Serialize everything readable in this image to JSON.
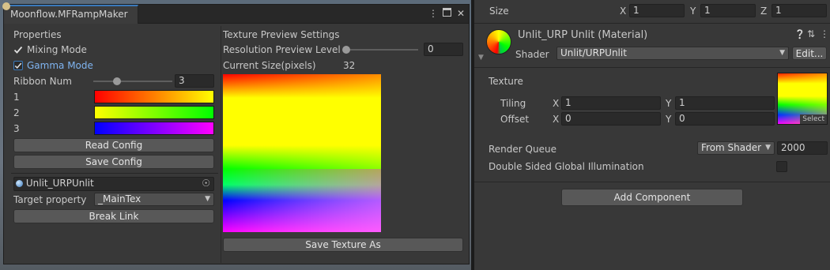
{
  "window": {
    "title": "Moonflow.MFRampMaker",
    "menu_icon": "kebab-menu-icon",
    "maximize_icon": "maximize-icon",
    "close_icon": "close-icon"
  },
  "properties": {
    "heading": "Properties",
    "mixing_mode": {
      "label": "Mixing Mode",
      "checked": true
    },
    "gamma_mode": {
      "label": "Gamma Mode",
      "checked": true
    },
    "ribbon_num": {
      "label": "Ribbon Num",
      "value": "3",
      "slider_fraction": 0.3
    },
    "ramps": [
      {
        "label": "1",
        "from": "#ff0000",
        "to": "#ffff00"
      },
      {
        "label": "2",
        "from": "#ffff00",
        "to": "#00ff00"
      },
      {
        "label": "3",
        "from": "#0000ff",
        "to": "#ff00ff"
      }
    ],
    "read_config": "Read Config",
    "save_config": "Save Config",
    "material_field": "Unlit_URPUnlit",
    "target_property": {
      "label": "Target property",
      "value": "_MainTex"
    },
    "break_link": "Break Link"
  },
  "texture_preview": {
    "heading": "Texture Preview Settings",
    "resolution_level": {
      "label": "Resolution Preview Level",
      "value": "0",
      "slider_fraction": 0.0
    },
    "current_size_label": "Current Size(pixels)",
    "current_size_value": "32",
    "save_texture": "Save Texture As"
  },
  "inspector": {
    "size": {
      "label": "Size",
      "x_label": "X",
      "x": "1",
      "y_label": "Y",
      "y": "1",
      "z_label": "Z",
      "z": "1"
    },
    "material": {
      "title": "Unlit_URP Unlit (Material)",
      "shader_label": "Shader",
      "shader_value": "Unlit/URPUnlit",
      "edit_button": "Edit...",
      "help_icon": "help-icon",
      "settings_icon": "preset-settings-icon",
      "menu_icon": "kebab-menu-icon"
    },
    "texture": {
      "label": "Texture",
      "tiling_label": "Tiling",
      "tiling_x_label": "X",
      "tiling_x": "1",
      "tiling_y_label": "Y",
      "tiling_y": "1",
      "offset_label": "Offset",
      "offset_x_label": "X",
      "offset_x": "0",
      "offset_y_label": "Y",
      "offset_y": "0",
      "select_label": "Select"
    },
    "render_queue": {
      "label": "Render Queue",
      "mode": "From Shader",
      "value": "2000"
    },
    "double_sided_gi": {
      "label": "Double Sided Global Illumination",
      "checked": false
    },
    "add_component": "Add Component"
  }
}
